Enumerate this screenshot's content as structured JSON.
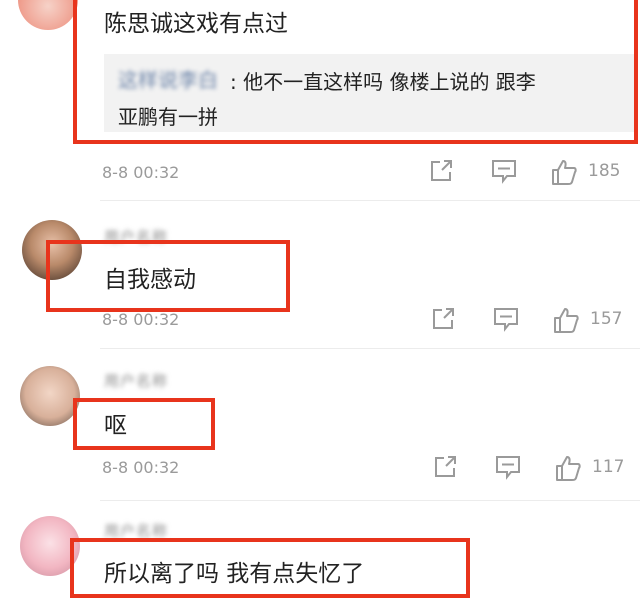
{
  "comments": [
    {
      "text": "陈思诚这戏有点过",
      "reply": {
        "user": "这样说李白",
        "line1": ": 他不一直这样吗 像楼上说的 跟李",
        "line2": "亚鹏有一拼"
      },
      "time": "8-8 00:32",
      "likes": "185"
    },
    {
      "username": "用户名称",
      "text": "自我感动",
      "time": "8-8 00:32",
      "likes": "157"
    },
    {
      "username": "用户名称",
      "text": "呕",
      "time": "8-8 00:32",
      "likes": "117"
    },
    {
      "username": "用户名称",
      "text": "所以离了吗 我有点失忆了"
    }
  ],
  "icons": {
    "share": "share-icon",
    "comment": "comment-icon",
    "like": "thumbs-up-icon"
  },
  "colors": {
    "highlight": "#e8341c",
    "reply_user": "#6b83a8",
    "meta": "#9a9a9a",
    "reply_bg": "#f2f2f2"
  }
}
